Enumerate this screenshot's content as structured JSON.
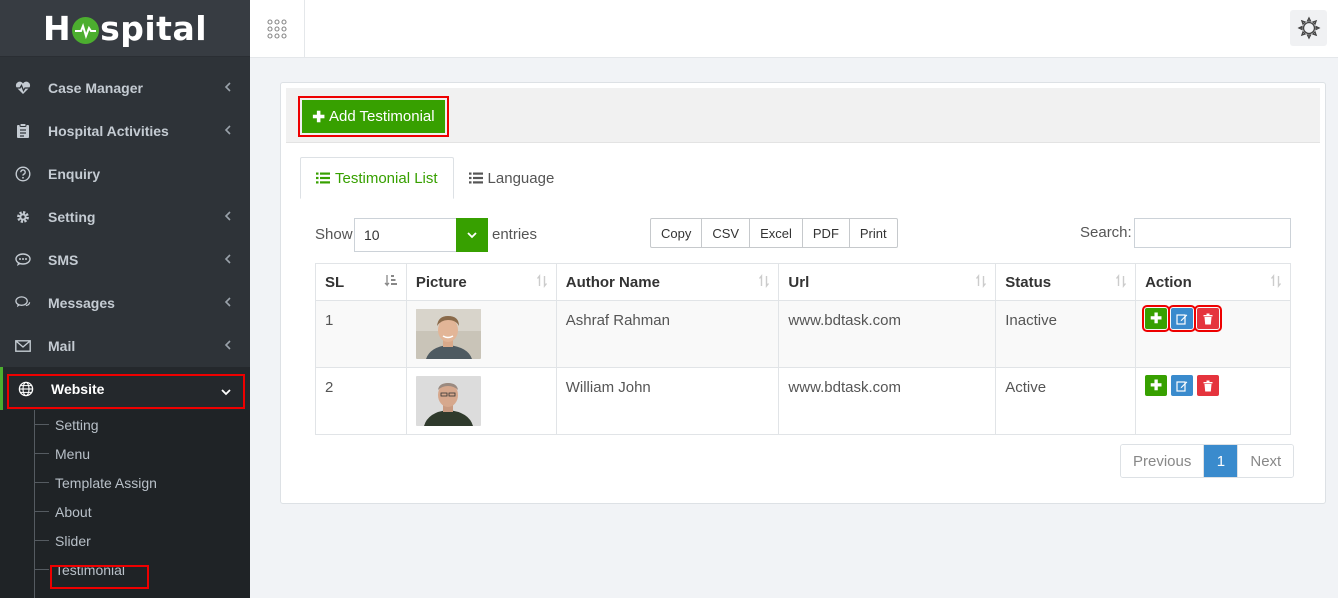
{
  "app": {
    "logo_prefix": "H",
    "logo_suffix": "spital"
  },
  "sidebar": {
    "items": [
      {
        "label": "Case Manager",
        "icon": "heartbeat-icon",
        "has_children": true
      },
      {
        "label": "Hospital Activities",
        "icon": "clipboard-icon",
        "has_children": true
      },
      {
        "label": "Enquiry",
        "icon": "question-circle-icon",
        "has_children": false
      },
      {
        "label": "Setting",
        "icon": "gear-icon",
        "has_children": true
      },
      {
        "label": "SMS",
        "icon": "chat-dots-icon",
        "has_children": true
      },
      {
        "label": "Messages",
        "icon": "comments-icon",
        "has_children": true
      },
      {
        "label": "Mail",
        "icon": "envelope-icon",
        "has_children": true
      },
      {
        "label": "Website",
        "icon": "globe-icon",
        "has_children": true,
        "active": true
      }
    ],
    "submenu": [
      "Setting",
      "Menu",
      "Template Assign",
      "About",
      "Slider",
      "Testimonial"
    ]
  },
  "panel": {
    "add_button": "Add Testimonial",
    "tabs": [
      "Testimonial List",
      "Language"
    ]
  },
  "controls": {
    "show_label": "Show",
    "page_size": "10",
    "entries_label": "entries",
    "export_buttons": [
      "Copy",
      "CSV",
      "Excel",
      "PDF",
      "Print"
    ],
    "search_label": "Search:"
  },
  "table": {
    "headers": [
      "SL",
      "Picture",
      "Author Name",
      "Url",
      "Status",
      "Action"
    ],
    "rows": [
      {
        "sl": "1",
        "author": "Ashraf Rahman",
        "url": "www.bdtask.com",
        "status": "Inactive"
      },
      {
        "sl": "2",
        "author": "William John",
        "url": "www.bdtask.com",
        "status": "Active"
      }
    ]
  },
  "pagination": {
    "previous": "Previous",
    "current": "1",
    "next": "Next"
  },
  "colors": {
    "accent": "#37a000",
    "primary": "#3a8bcd",
    "danger": "#e5343d",
    "sidebar": "#2e3338"
  }
}
